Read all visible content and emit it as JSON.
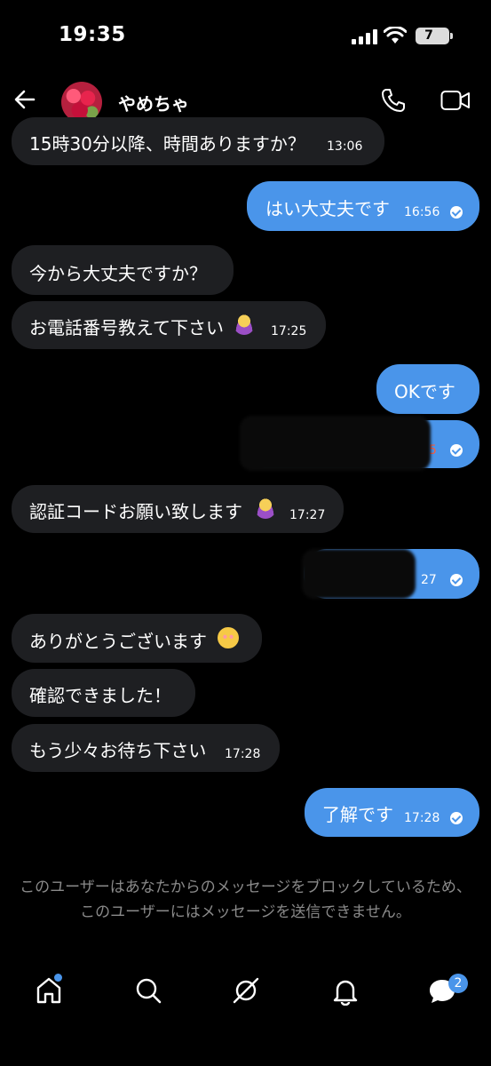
{
  "status_bar": {
    "time": "19:35",
    "battery": "7"
  },
  "header": {
    "name": "やめちゃ"
  },
  "messages": [
    {
      "dir": "in",
      "text": "15時30分以降、時間ありますか？",
      "time": "13:06"
    },
    {
      "dir": "out",
      "text": "はい大丈夫です",
      "time": "16:56",
      "read": true
    },
    {
      "dir": "in",
      "text": "今から大丈夫ですか？",
      "time": ""
    },
    {
      "dir": "in",
      "text": "お電話番号教えて下さい",
      "time": "17:25"
    },
    {
      "dir": "out",
      "text": "OKです",
      "time": ""
    },
    {
      "dir": "out",
      "text": "",
      "time": "5",
      "redacted": true
    },
    {
      "dir": "in",
      "text": "認証コードお願い致します",
      "time": "17:27"
    },
    {
      "dir": "out",
      "text": "",
      "time": "27",
      "redacted": true
    },
    {
      "dir": "in",
      "text": "ありがとうございます",
      "time": ""
    },
    {
      "dir": "in",
      "text": "確認できました！",
      "time": ""
    },
    {
      "dir": "in",
      "text": "もう少々お待ち下さい",
      "time": "17:28"
    },
    {
      "dir": "out",
      "text": "了解です",
      "time": "17:28",
      "read": true
    }
  ],
  "notice": "このユーザーはあなたからのメッセージをブロックしているため、このユーザーにはメッセージを送信できません。",
  "tabbar": {
    "messages_badge": "2"
  },
  "colors": {
    "accent": "#4a95ea",
    "incoming_bubble": "#1e1f22",
    "background": "#000000"
  }
}
